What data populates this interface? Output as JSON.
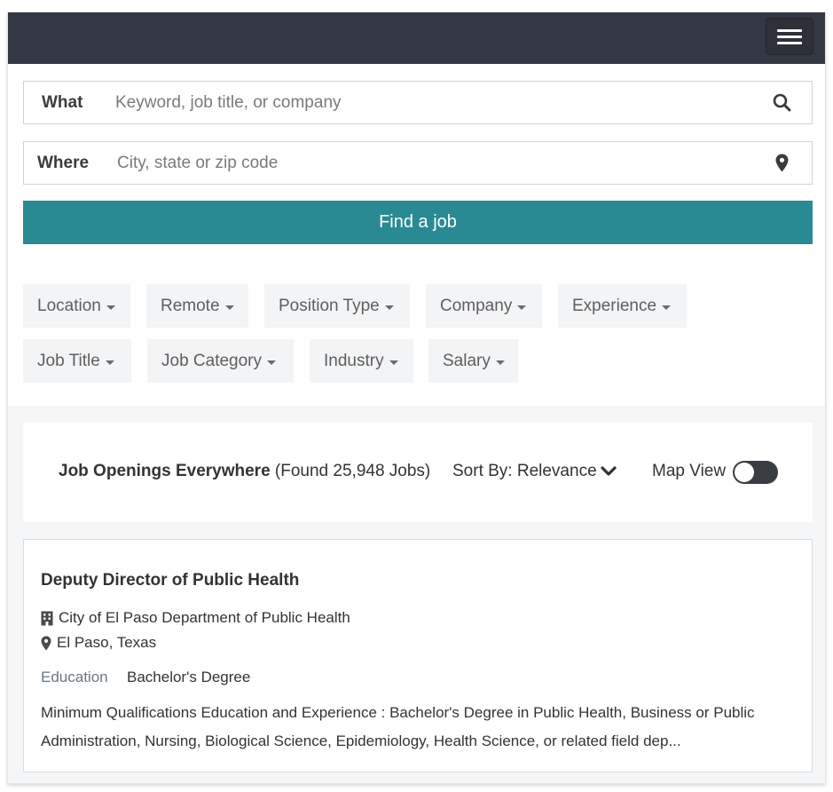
{
  "header": {
    "menu_icon": "hamburger-menu-icon"
  },
  "search": {
    "what_label": "What",
    "what_placeholder": "Keyword, job title, or company",
    "what_value": "",
    "where_label": "Where",
    "where_placeholder": "City, state or zip code",
    "where_value": "",
    "submit_label": "Find a job",
    "accent_color": "#298a94"
  },
  "filters": {
    "location": "Location",
    "remote": "Remote",
    "position_type": "Position Type",
    "company": "Company",
    "experience": "Experience",
    "job_title": "Job Title",
    "job_category": "Job Category",
    "industry": "Industry",
    "salary": "Salary"
  },
  "results": {
    "heading": "Job Openings Everywhere",
    "count_text": "(Found 25,948 Jobs)",
    "sort_label": "Sort By: Relevance",
    "map_view_label": "Map View",
    "map_view_enabled": false
  },
  "jobs": [
    {
      "title": "Deputy Director of Public Health",
      "company": "City of El Paso Department of Public Health",
      "location": "El Paso, Texas",
      "education_label": "Education",
      "education_value": "Bachelor's Degree",
      "description": "Minimum Qualifications Education and Experience : Bachelor's Degree in Public Health, Business or Public Administration, Nursing, Biological Science, Epidemiology, Health Science, or related field dep..."
    }
  ]
}
